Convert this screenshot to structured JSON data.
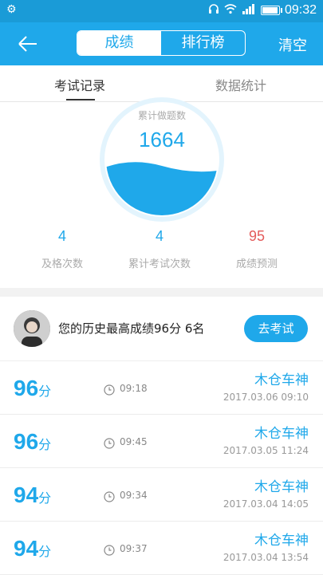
{
  "status": {
    "time": "09:32"
  },
  "header": {
    "tabs": [
      "成绩",
      "排行榜"
    ],
    "active_tab": 0,
    "clear_label": "清空"
  },
  "subtabs": {
    "items": [
      "考试记录",
      "数据统计"
    ],
    "active": 0
  },
  "summary": {
    "circle_label": "累计做题数",
    "circle_value": "1664",
    "stats": [
      {
        "value": "4",
        "label": "及格次数",
        "color": "#1fa8ea"
      },
      {
        "value": "4",
        "label": "累计考试次数",
        "color": "#1fa8ea"
      },
      {
        "value": "95",
        "label": "成绩预测",
        "color": "#e35b5b"
      }
    ]
  },
  "best": {
    "text": "您的历史最高成绩96分  6名",
    "button": "去考试"
  },
  "records": [
    {
      "score": "96",
      "unit": "分",
      "duration": "09:18",
      "name": "木仓车神",
      "date": "2017.03.06   09:10"
    },
    {
      "score": "96",
      "unit": "分",
      "duration": "09:45",
      "name": "木仓车神",
      "date": "2017.03.05   11:24"
    },
    {
      "score": "94",
      "unit": "分",
      "duration": "09:34",
      "name": "木仓车神",
      "date": "2017.03.04   14:05"
    },
    {
      "score": "94",
      "unit": "分",
      "duration": "09:37",
      "name": "木仓车神",
      "date": "2017.03.04   13:54"
    }
  ],
  "colors": {
    "primary": "#1fa8ea",
    "statusbar": "#1a9bd7",
    "prediction": "#e35b5b"
  }
}
